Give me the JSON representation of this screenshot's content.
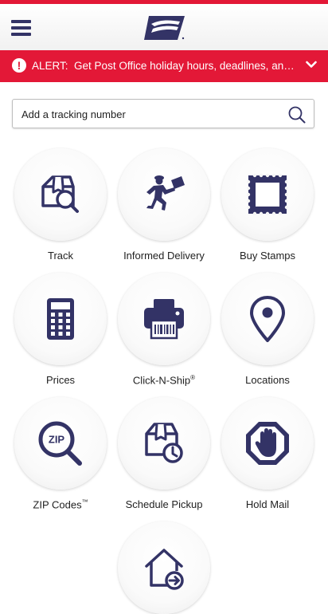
{
  "header": {
    "menu_icon": "hamburger-menu-icon",
    "logo_icon": "usps-eagle-logo",
    "colors": {
      "brand_red": "#e31837",
      "brand_navy": "#333366"
    }
  },
  "alert": {
    "label": "ALERT:",
    "message": "Get Post Office holiday hours, deadlines, and ti…",
    "icon": "exclamation-circle-icon",
    "chevron_icon": "chevron-down-icon"
  },
  "search": {
    "placeholder": "Add a tracking number",
    "value": "",
    "icon": "search-icon"
  },
  "tiles": [
    {
      "label": "Track",
      "icon": "package-search-icon"
    },
    {
      "label": "Informed Delivery",
      "icon": "mail-carrier-icon"
    },
    {
      "label": "Buy Stamps",
      "icon": "stamp-icon"
    },
    {
      "label": "Prices",
      "icon": "calculator-icon"
    },
    {
      "label": "Click-N-Ship",
      "mark": "®",
      "icon": "printer-icon"
    },
    {
      "label": "Locations",
      "icon": "location-pin-icon"
    },
    {
      "label": "ZIP Codes",
      "mark": "™",
      "icon": "zip-magnifier-icon"
    },
    {
      "label": "Schedule Pickup",
      "icon": "package-clock-icon"
    },
    {
      "label": "Hold Mail",
      "icon": "hand-stop-icon"
    },
    {
      "label": "",
      "icon": "house-arrow-icon"
    }
  ]
}
